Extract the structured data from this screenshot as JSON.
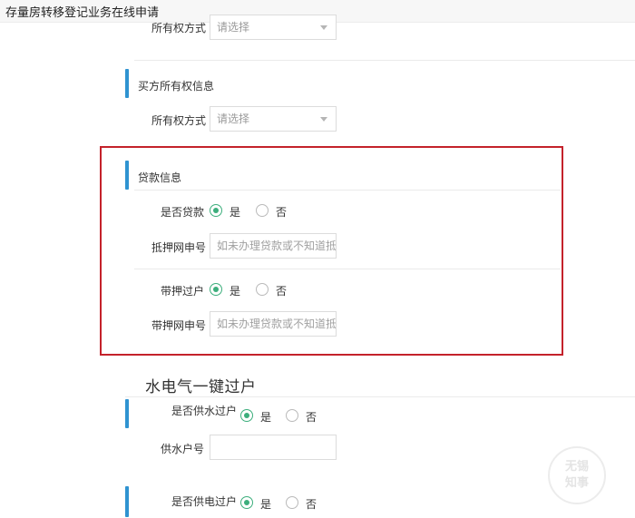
{
  "window": {
    "title": "存量房转移登记业务在线申请"
  },
  "seller_section": {
    "ownership_label": "所有权方式",
    "ownership_value": "请选择"
  },
  "buyer_section": {
    "title": "买方所有权信息",
    "ownership_label": "所有权方式",
    "ownership_value": "请选择"
  },
  "loan_section": {
    "title": "贷款信息",
    "has_loan_label": "是否贷款",
    "has_loan_options": [
      "是",
      "否"
    ],
    "has_loan_selected": "是",
    "mortgage_no_label": "抵押网申号",
    "mortgage_no_placeholder": "如未办理贷款或不知道抵押网",
    "transfer_with_mortgage_label": "带押过户",
    "transfer_options": [
      "是",
      "否"
    ],
    "transfer_selected": "是",
    "transfer_mortgage_no_label": "带押网申号",
    "transfer_mortgage_no_placeholder": "如未办理贷款或不知道抵押网"
  },
  "utility_section": {
    "title": "水电气一键过户",
    "water_label": "是否供水过户",
    "water_options": [
      "是",
      "否"
    ],
    "water_selected": "是",
    "water_account_label": "供水户号",
    "water_account_value": "",
    "power_label": "是否供电过户",
    "power_options": [
      "是",
      "否"
    ],
    "power_selected": "是"
  },
  "watermark": {
    "line1": "无锡",
    "line2": "知事"
  },
  "colors": {
    "accent_blue": "#2f93d1",
    "radio_green": "#3cae7c",
    "highlight_red": "#c4222b"
  }
}
